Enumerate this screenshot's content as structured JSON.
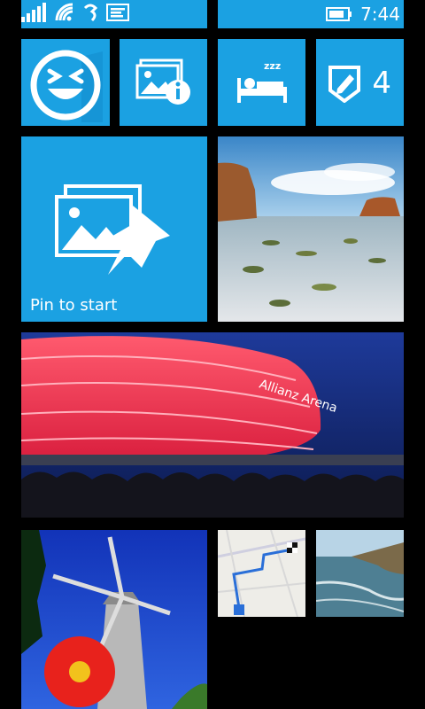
{
  "status": {
    "time": "7:44",
    "icons": [
      "signal-bars-icon",
      "wifi-icon",
      "data-sync-icon",
      "message-icon",
      "battery-icon"
    ]
  },
  "tiles": {
    "emoji": {
      "icon": "laughing-face-icon"
    },
    "photo_info": {
      "icon": "photo-info-icon"
    },
    "sleep": {
      "icon": "sleep-bed-icon"
    },
    "notes": {
      "icon": "pencil-shield-icon",
      "count": "4"
    },
    "pin": {
      "icon": "photo-pin-icon",
      "label": "Pin to start"
    },
    "stadium": {
      "sign": "Allianz Arena"
    }
  },
  "colors": {
    "accent": "#1ba1e2",
    "background": "#000000"
  }
}
